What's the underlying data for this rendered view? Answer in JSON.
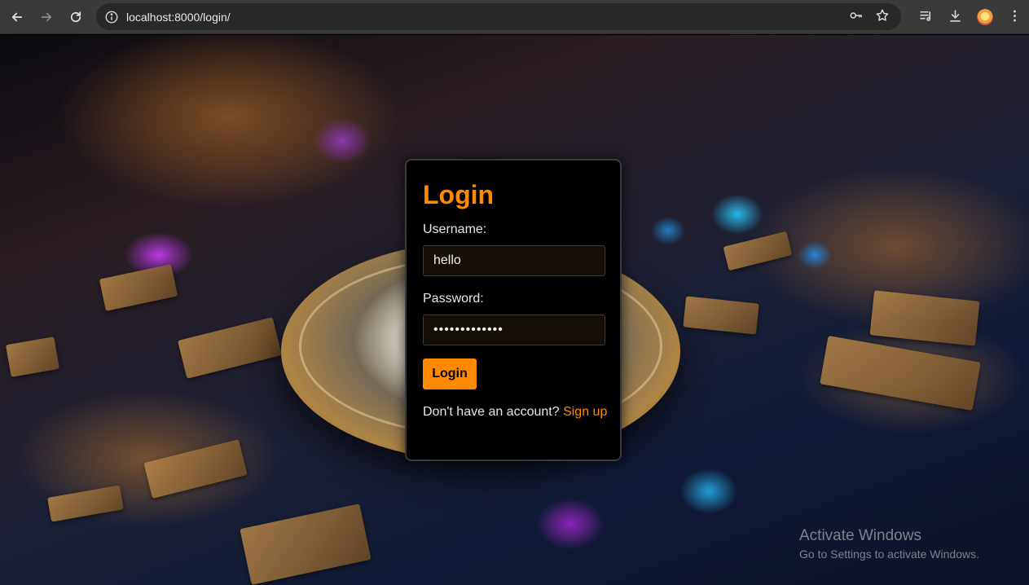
{
  "browser": {
    "url": "localhost:8000/login/",
    "back_icon": "arrow-left-icon",
    "forward_icon": "arrow-right-icon",
    "reload_icon": "reload-icon",
    "site_info_icon": "info-icon",
    "password_key_icon": "key-icon",
    "bookmark_icon": "star-icon",
    "reading_list_icon": "reading-list-icon",
    "downloads_icon": "download-icon",
    "profile_icon": "avatar",
    "menu_icon": "kebab-menu-icon"
  },
  "login": {
    "title": "Login",
    "username_label": "Username:",
    "username_value": "hello",
    "password_label": "Password:",
    "password_value": "•••••••••••••",
    "submit_label": "Login",
    "signup_prompt": "Don't have an account?",
    "signup_link": "Sign up"
  },
  "colors": {
    "accent": "#ff8a00",
    "card_background": "#000000",
    "input_background": "#140e06"
  },
  "watermark": {
    "title": "Activate Windows",
    "subtitle": "Go to Settings to activate Windows."
  }
}
